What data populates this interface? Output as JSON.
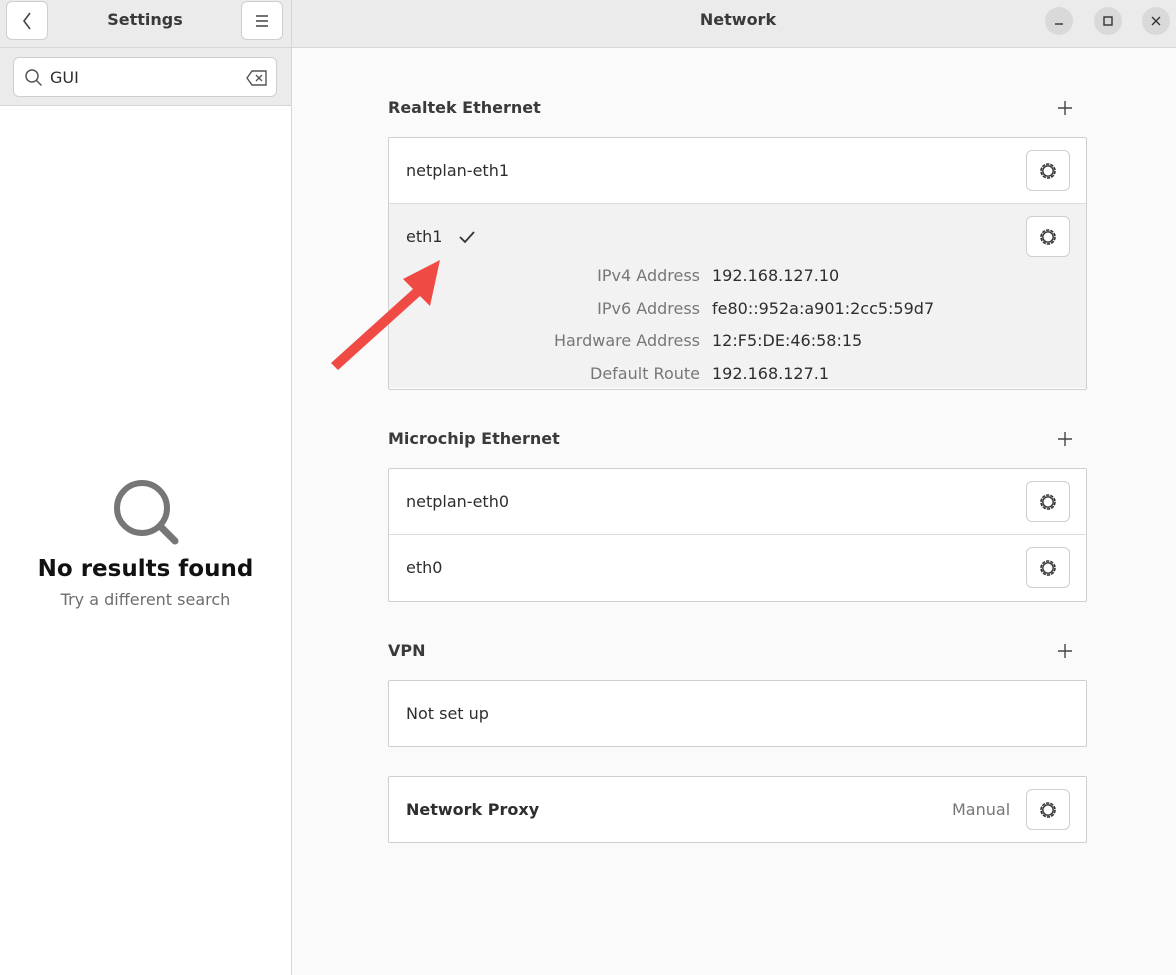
{
  "sidebar": {
    "title": "Settings",
    "search": {
      "value": "GUI",
      "placeholder": ""
    },
    "empty": {
      "title": "No results found",
      "subtitle": "Try a different search"
    }
  },
  "main": {
    "title": "Network",
    "sections": {
      "realtek": {
        "label": "Realtek Ethernet",
        "rows": [
          {
            "label": "netplan-eth1"
          },
          {
            "label": "eth1"
          }
        ],
        "details": [
          {
            "key": "IPv4 Address",
            "value": "192.168.127.10"
          },
          {
            "key": "IPv6 Address",
            "value": "fe80::952a:a901:2cc5:59d7"
          },
          {
            "key": "Hardware Address",
            "value": "12:F5:DE:46:58:15"
          },
          {
            "key": "Default Route",
            "value": "192.168.127.1"
          }
        ]
      },
      "microchip": {
        "label": "Microchip Ethernet",
        "rows": [
          {
            "label": "netplan-eth0"
          },
          {
            "label": "eth0"
          }
        ]
      },
      "vpn": {
        "label": "VPN",
        "status": "Not set up"
      },
      "proxy": {
        "label": "Network Proxy",
        "status": "Manual"
      }
    }
  },
  "icons": {
    "back": "chevron-left-icon",
    "menu": "hamburger-icon",
    "search": "search-icon",
    "clear": "backspace-icon",
    "gear": "gear-icon",
    "check": "checkmark-icon",
    "add": "plus-icon",
    "annotation": "red-arrow-icon"
  },
  "colors": {
    "accent_arrow": "#f04a45",
    "header_bg": "#ebebeb",
    "sidebar_bg": "#ffffff",
    "main_bg": "#fafafa"
  }
}
